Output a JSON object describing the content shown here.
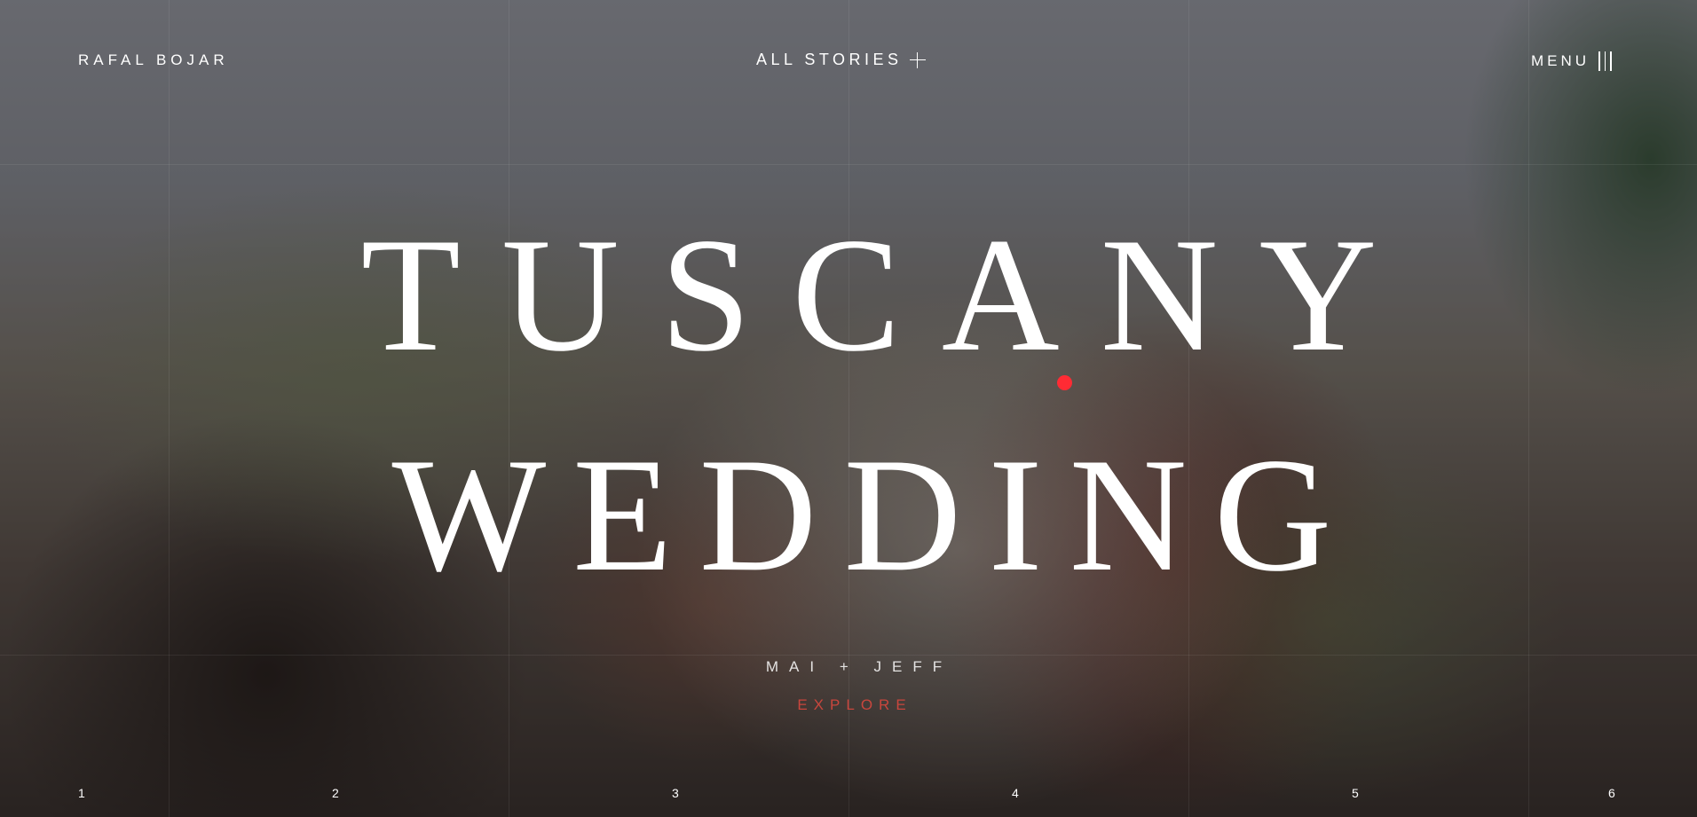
{
  "header": {
    "brand": "RAFAL BOJAR",
    "stories_label": "ALL STORIES",
    "stories_icon": "plus-icon",
    "menu_label": "MENU",
    "menu_icon": "vertical-bars-icon"
  },
  "hero": {
    "title_line_1": "TUSCANY",
    "title_line_2": "WEDDING",
    "couple": "MAI + JEFF",
    "explore_label": "EXPLORE",
    "accent_color": "#ff2b34",
    "explore_color": "#c9463d"
  },
  "slides": [
    "1",
    "2",
    "3",
    "4",
    "5",
    "6"
  ]
}
